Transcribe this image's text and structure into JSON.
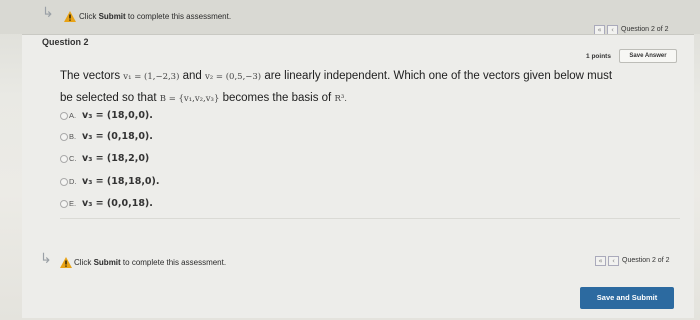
{
  "header": {
    "notice_prefix": "Click",
    "notice_bold": "Submit",
    "notice_suffix": "to complete this assessment.",
    "question_count": "Question 2 of 2",
    "prev_icon": "double-chevron-left-icon",
    "back_icon": "chevron-left-icon"
  },
  "question": {
    "label": "Question 2",
    "points": "1 points",
    "save_answer": "Save Answer",
    "text_line1_a": "The vectors",
    "v1_def": "v₁ = (1,−2,3)",
    "text_and": "and",
    "v2_def": "v₂ = (0,5,−3)",
    "text_line1_b": "are linearly independent. Which one of the vectors given below must",
    "text_line2_a": "be selected so that",
    "basis_def": "B = {v₁,v₂,v₃}",
    "text_line2_b": "becomes the basis of",
    "space": "R³."
  },
  "options": [
    {
      "letter": "A.",
      "text": "v₃ = (18,0,0)."
    },
    {
      "letter": "B.",
      "text": "v₃ = (0,18,0)."
    },
    {
      "letter": "C.",
      "text": "v₃ = (18,2,0)"
    },
    {
      "letter": "D.",
      "text": "v₃ = (18,18,0)."
    },
    {
      "letter": "E.",
      "text": "v₃ = (0,0,18)."
    }
  ],
  "footer": {
    "notice_prefix": "Click",
    "notice_bold": "Submit",
    "notice_suffix": "to complete this assessment.",
    "question_count": "Question 2 of 2",
    "submit_label": "Save and Submit"
  },
  "colors": {
    "warning": "#e8a317",
    "submit_bg": "#2c6aa0"
  }
}
